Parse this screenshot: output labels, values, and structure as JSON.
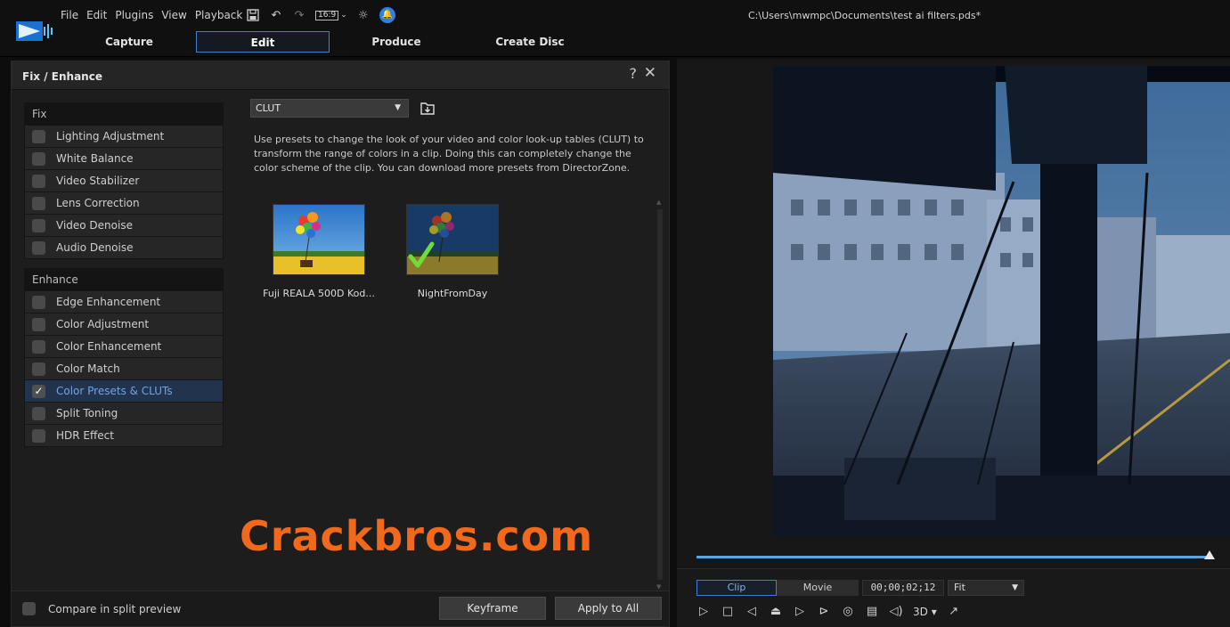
{
  "menu": [
    "File",
    "Edit",
    "Plugins",
    "View",
    "Playback"
  ],
  "toolbar": {
    "aspect_label": "16:9",
    "icons": [
      "save-icon",
      "undo-icon",
      "redo-icon",
      "aspect-ratio-icon",
      "settings-icon",
      "notification-bell-icon"
    ]
  },
  "file_path": "C:\\Users\\mwmpc\\Documents\\test ai filters.pds*",
  "mode_tabs": [
    {
      "label": "Capture",
      "active": false
    },
    {
      "label": "Edit",
      "active": true
    },
    {
      "label": "Produce",
      "active": false
    },
    {
      "label": "Create Disc",
      "active": false
    }
  ],
  "panel": {
    "title": "Fix / Enhance",
    "help_glyph": "?",
    "close_glyph": "✕",
    "fix": {
      "header": "Fix",
      "items": [
        {
          "label": "Lighting Adjustment",
          "checked": false
        },
        {
          "label": "White Balance",
          "checked": false
        },
        {
          "label": "Video Stabilizer",
          "checked": false
        },
        {
          "label": "Lens Correction",
          "checked": false
        },
        {
          "label": "Video Denoise",
          "checked": false
        },
        {
          "label": "Audio Denoise",
          "checked": false
        }
      ]
    },
    "enhance": {
      "header": "Enhance",
      "items": [
        {
          "label": "Edge Enhancement",
          "checked": false
        },
        {
          "label": "Color Adjustment",
          "checked": false
        },
        {
          "label": "Color Enhancement",
          "checked": false
        },
        {
          "label": "Color Match",
          "checked": false
        },
        {
          "label": "Color Presets & CLUTs",
          "checked": true,
          "selected": true
        },
        {
          "label": "Split Toning",
          "checked": false
        },
        {
          "label": "HDR Effect",
          "checked": false
        }
      ]
    },
    "dropdown": {
      "value": "CLUT"
    },
    "description": "Use presets to change the look of your video and color look-up tables (CLUT) to transform the range of colors in a clip. Doing this can completely change the color scheme of the clip. You can download more presets from DirectorZone.",
    "presets": [
      {
        "label": "Fuji REALA 500D Kod...",
        "applied": false
      },
      {
        "label": "NightFromDay",
        "applied": true
      }
    ],
    "footer": {
      "compare_label": "Compare in split preview",
      "keyframe_label": "Keyframe",
      "apply_all_label": "Apply to All"
    }
  },
  "watermark": "Crackbros.com",
  "preview": {
    "progress": 1.0,
    "clip_label": "Clip",
    "movie_label": "Movie",
    "timecode": "00;00;02;12",
    "fit_value": "Fit",
    "threed_label": "3D"
  },
  "colors": {
    "accent": "#3f7ed6",
    "selected_text": "#6fa4e4",
    "watermark": "#f2691c",
    "timeline": "#5aa6e0"
  }
}
